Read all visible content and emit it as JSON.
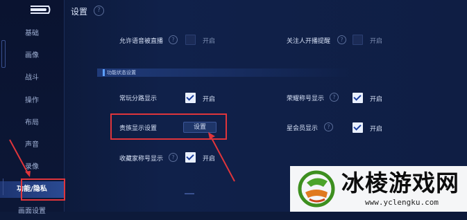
{
  "header": {
    "title": "设置"
  },
  "sidebar": {
    "items": [
      {
        "label": "基础"
      },
      {
        "label": "画像"
      },
      {
        "label": "战斗"
      },
      {
        "label": "操作"
      },
      {
        "label": "布局"
      },
      {
        "label": "声音"
      },
      {
        "label": "录像"
      },
      {
        "label": "功能/隐私"
      },
      {
        "label": "画面设置"
      }
    ],
    "active_index": 7
  },
  "top_rows": [
    {
      "label": "允许语音被直播",
      "state": "开启",
      "checked": false
    },
    {
      "label": "关注人开播提醒",
      "state": "开启",
      "checked": false
    }
  ],
  "section": {
    "title": "功能状态设置"
  },
  "rows": [
    {
      "label": "常玩分路显示",
      "state": "开启",
      "checked": true
    },
    {
      "label": "荣耀称号显示",
      "state": "开启",
      "checked": true
    },
    {
      "label": "贵族显示设置",
      "button": "设置"
    },
    {
      "label": "星会员显示",
      "state": "开启",
      "checked": true
    },
    {
      "label": "收藏家称号显示",
      "state": "开启",
      "checked": true
    }
  ],
  "watermark": {
    "title": "冰棱游戏网",
    "url": "www.yclengku.com"
  },
  "colors": {
    "highlight": "#e0353b",
    "accent": "#5da0ff",
    "background": "#0d1a3a"
  }
}
